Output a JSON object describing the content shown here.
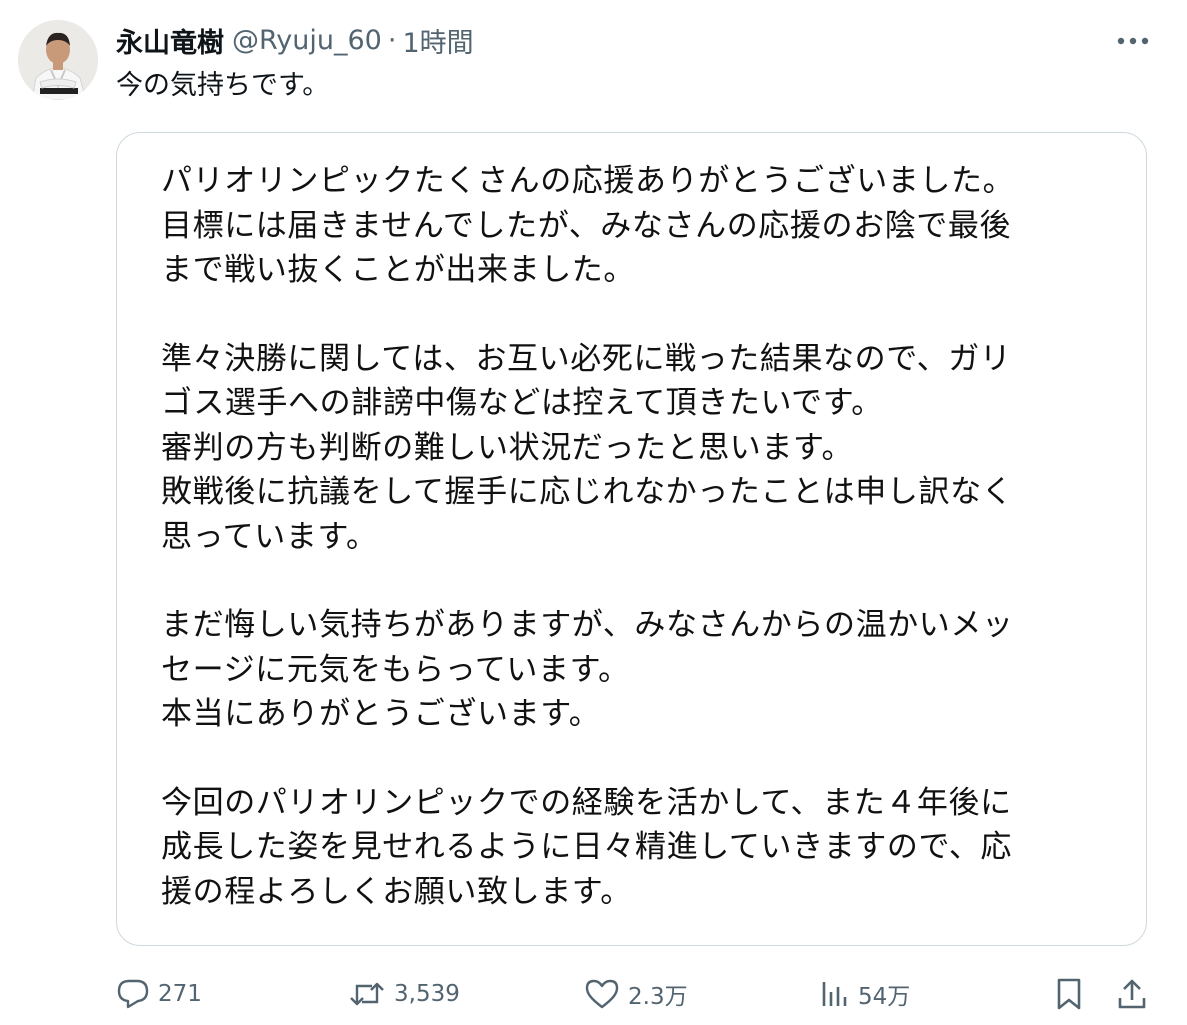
{
  "tweet": {
    "display_name": "永山竜樹",
    "handle": "@Ryuju_60",
    "separator": "·",
    "time": "1時間",
    "text": "今の気持ちです。"
  },
  "card": {
    "paragraphs": [
      [
        "パリオリンピックたくさんの応援ありがとうございました。",
        "目標には届きませんでしたが、みなさんの応援のお陰で最後",
        "まで戦い抜くことが出来ました。"
      ],
      [
        "準々決勝に関しては、お互い必死に戦った結果なので、ガリ",
        "ゴス選手への誹謗中傷などは控えて頂きたいです。",
        "審判の方も判断の難しい状況だったと思います。",
        "敗戦後に抗議をして握手に応じれなかったことは申し訳なく",
        "思っています。"
      ],
      [
        "まだ悔しい気持ちがありますが、みなさんからの温かいメッ",
        "セージに元気をもらっています。",
        "本当にありがとうございます。"
      ],
      [
        "今回のパリオリンピックでの経験を活かして、また４年後に",
        "成長した姿を見せれるように日々精進していきますので、応",
        "援の程よろしくお願い致します。"
      ]
    ]
  },
  "actions": {
    "reply_count": "271",
    "repost_count": "3,539",
    "like_count": "2.3万",
    "views_count": "54万"
  },
  "icons": {
    "more": "more-icon",
    "reply": "reply-icon",
    "repost": "repost-icon",
    "like": "like-icon",
    "views": "views-icon",
    "bookmark": "bookmark-icon",
    "share": "share-icon"
  },
  "colors": {
    "text_primary": "#0f1419",
    "text_secondary": "#536471",
    "card_border": "#cfd9de"
  }
}
